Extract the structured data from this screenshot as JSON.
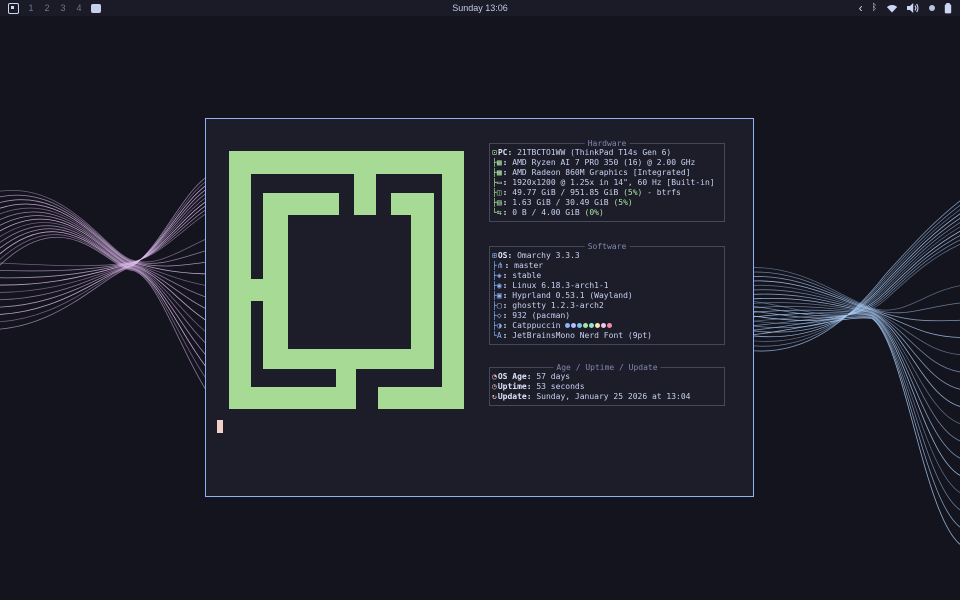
{
  "topbar": {
    "apps_icon": "apps-grid",
    "workspaces": [
      "1",
      "2",
      "3",
      "4"
    ],
    "clock": "Sunday 13:06",
    "tray": {
      "chevron": "‹",
      "bluetooth_icon": "bluetooth",
      "wifi_icon": "wifi",
      "volume_icon": "volume",
      "status_dot_icon": "status-dot",
      "battery_icon": "battery"
    }
  },
  "terminal": {
    "sections": [
      {
        "title": "Hardware",
        "rows": [
          {
            "icon": "⊡",
            "label": "PC: ",
            "text": "21TBCTO1WW (ThinkPad T14s Gen 6)"
          },
          {
            "tree": "├",
            "icon": "▦",
            "label": ": ",
            "text": "AMD Ryzen AI 7 PRO 350 (16) @ 2.00 GHz"
          },
          {
            "tree": "├",
            "icon": "▩",
            "label": ": ",
            "text": "AMD Radeon 860M Graphics [Integrated]"
          },
          {
            "tree": "├",
            "icon": "▭",
            "label": ": ",
            "text": "1920x1200 @ 1.25x in 14\", 60 Hz [Built-in]"
          },
          {
            "tree": "├",
            "icon": "◫",
            "label": ": ",
            "text": "49.77 GiB / 951.85 GiB ",
            "pct": "(5%)",
            "post": " - btrfs"
          },
          {
            "tree": "├",
            "icon": "▤",
            "label": ": ",
            "text": "1.63 GiB / 30.49 GiB ",
            "pct": "(5%)"
          },
          {
            "tree": "└",
            "icon": "⇆",
            "label": ": ",
            "text": "0 B / 4.00 GiB ",
            "pct": "(0%)"
          }
        ]
      },
      {
        "title": "Software",
        "rows": [
          {
            "icon": "⊞",
            "label": "OS: ",
            "text": "Omarchy 3.3.3"
          },
          {
            "tree": "├",
            "icon": "⋔",
            "label": ": ",
            "text": "master"
          },
          {
            "tree": "├",
            "icon": "◈",
            "label": ": ",
            "text": "stable"
          },
          {
            "tree": "├",
            "icon": "◉",
            "label": ": ",
            "text": "Linux 6.18.3-arch1-1"
          },
          {
            "tree": "├",
            "icon": "▣",
            "label": ": ",
            "text": "Hyprland 0.53.1 (Wayland)"
          },
          {
            "tree": "├",
            "icon": "▢",
            "label": ": ",
            "text": "ghostty 1.2.3-arch2"
          },
          {
            "tree": "├",
            "icon": "◇",
            "label": ": ",
            "text": "932 (pacman)"
          },
          {
            "tree": "├",
            "icon": "◑",
            "label": ": ",
            "text": "Catppuccin "
          },
          {
            "tree": "└",
            "icon": "A",
            "label": ": ",
            "text": "JetBrainsMono Nerd Font (9pt)"
          }
        ]
      },
      {
        "title": "Age / Uptime / Update",
        "rows": [
          {
            "icon": "◔",
            "label": "OS Age: ",
            "text": "57 days"
          },
          {
            "icon": "◷",
            "label": "Uptime: ",
            "text": "53 seconds"
          },
          {
            "icon": "↻",
            "label": "Update: ",
            "text": "Sunday, January 25 2026 at 13:04"
          }
        ]
      }
    ]
  },
  "theme_dots": [
    "#89b4fa",
    "#b4befe",
    "#74c7ec",
    "#a6e3a1",
    "#94e2d5",
    "#f9e2af",
    "#f5c2e7",
    "#f38ba8"
  ],
  "colors": {
    "desktop_bg": "#14141e",
    "terminal_bg": "#1d1d2a",
    "terminal_border": "#8fb2f7",
    "logo_green": "#a6da95",
    "accent_green": "#a6e3a1",
    "accent_blue": "#89b4fa",
    "age_icon_pink": "#f0c6c6",
    "wave_pink": "#e3bdf2",
    "wave_blue": "#a9cdf6",
    "text": "#c7d1f0"
  }
}
